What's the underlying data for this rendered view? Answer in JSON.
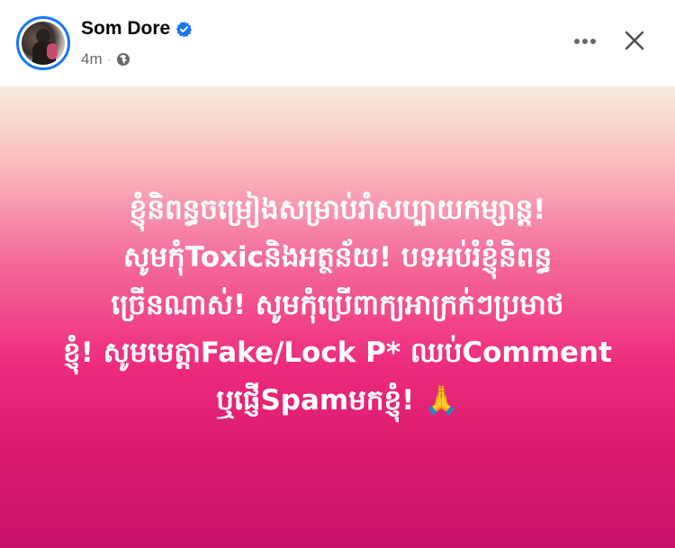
{
  "post": {
    "author": "Som Dore",
    "time": "4m",
    "body_lines": [
      "ខ្ញុំនិពន្ធចម្រៀងសម្រាប់រាំសប្បាយកម្សាន្ត!",
      "សូមកុំToxicនិងអត្ថន័យ! បទអប់រំខ្ញុំនិពន្ធ",
      "ច្រើនណាស់! សូមកុំប្រើពាក្យអាក្រក់ៗប្រមាថ",
      "ខ្ញុំ! សូមមេត្តាFake/Lock P* ឈប់Comment",
      "ឬផ្ញើSpamមកខ្ញុំ! 🙏"
    ]
  },
  "icons": {
    "verified": "verified-badge-icon",
    "audience": "globe-icon",
    "more": "more-horizontal-icon",
    "close": "close-icon"
  },
  "colors": {
    "verified_blue": "#1877f2",
    "text_primary": "#050505",
    "text_secondary": "#65676b",
    "background_gradient": [
      "#f7ecdc",
      "#f46a9a",
      "#ee2c7d",
      "#c8126a"
    ],
    "post_text": "#ffffff"
  }
}
